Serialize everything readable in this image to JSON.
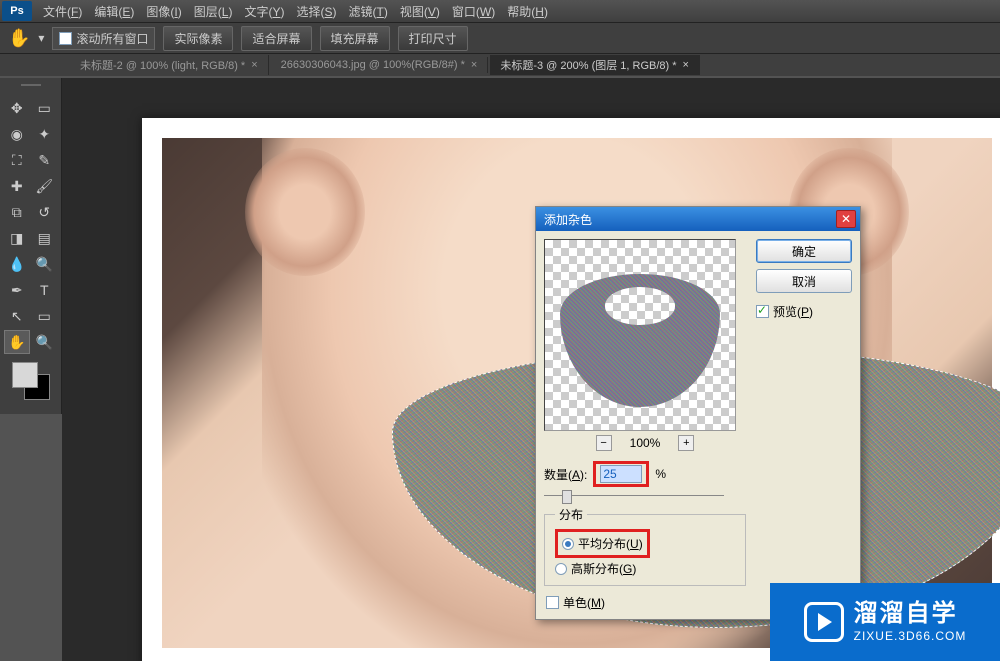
{
  "menu": {
    "logo": "Ps",
    "items": [
      {
        "label": "文件",
        "key": "F"
      },
      {
        "label": "编辑",
        "key": "E"
      },
      {
        "label": "图像",
        "key": "I"
      },
      {
        "label": "图层",
        "key": "L"
      },
      {
        "label": "文字",
        "key": "Y"
      },
      {
        "label": "选择",
        "key": "S"
      },
      {
        "label": "滤镜",
        "key": "T"
      },
      {
        "label": "视图",
        "key": "V"
      },
      {
        "label": "窗口",
        "key": "W"
      },
      {
        "label": "帮助",
        "key": "H"
      }
    ]
  },
  "options": {
    "scroll_all": "滚动所有窗口",
    "buttons": [
      "实际像素",
      "适合屏幕",
      "填充屏幕",
      "打印尺寸"
    ]
  },
  "doc_tabs": [
    {
      "label": "未标题-2 @ 100% (light, RGB/8) *",
      "active": false
    },
    {
      "label": "26630306043.jpg @ 100%(RGB/8#) *",
      "active": false
    },
    {
      "label": "未标题-3 @ 200% (图层 1, RGB/8) *",
      "active": true
    }
  ],
  "dialog": {
    "title": "添加杂色",
    "ok": "确定",
    "cancel": "取消",
    "preview_label": "预览",
    "preview_key": "P",
    "zoom": "100%",
    "amount_label": "数量",
    "amount_key": "A",
    "amount_value": "25",
    "amount_unit": "%",
    "dist_legend": "分布",
    "dist_uniform": "平均分布",
    "dist_uniform_key": "U",
    "dist_gaussian": "高斯分布",
    "dist_gaussian_key": "G",
    "mono_label": "单色",
    "mono_key": "M"
  },
  "watermark": {
    "big": "溜溜自学",
    "small": "ZIXUE.3D66.COM"
  }
}
